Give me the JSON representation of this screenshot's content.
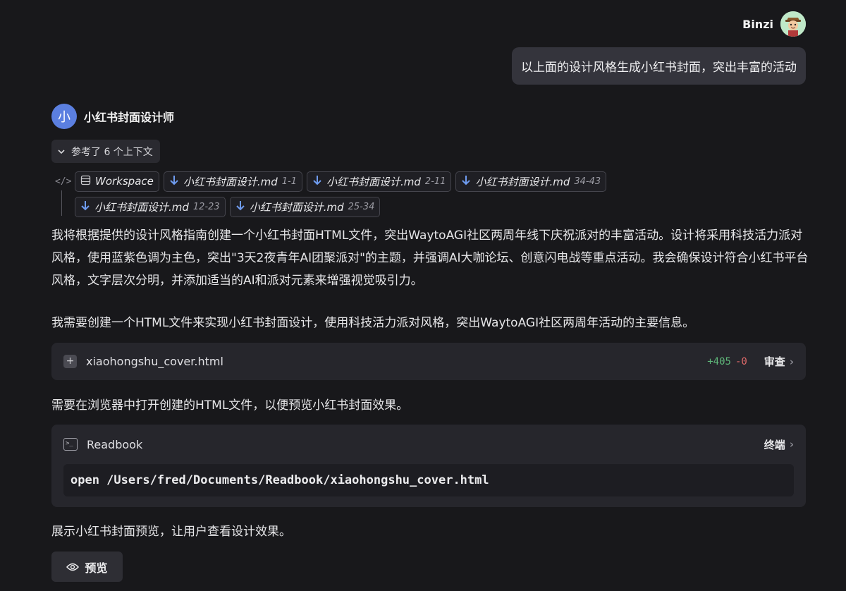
{
  "user": {
    "name": "Binzi",
    "message": "以上面的设计风格生成小红书封面，突出丰富的活动"
  },
  "assistant": {
    "avatar_text": "小",
    "name": "小红书封面设计师",
    "context_button": "参考了 6 个上下文",
    "context_row1": [
      {
        "label": "Workspace",
        "range": "",
        "icon": "database-icon"
      },
      {
        "label": "小红书封面设计.md",
        "range": "1-1",
        "icon": "arrow-down-icon"
      },
      {
        "label": "小红书封面设计.md",
        "range": "2-11",
        "icon": "arrow-down-icon"
      },
      {
        "label": "小红书封面设计.md",
        "range": "34-43",
        "icon": "arrow-down-icon"
      }
    ],
    "context_row2": [
      {
        "label": "小红书封面设计.md",
        "range": "12-23",
        "icon": "arrow-down-icon"
      },
      {
        "label": "小红书封面设计.md",
        "range": "25-34",
        "icon": "arrow-down-icon"
      }
    ],
    "para1": "我将根据提供的设计风格指南创建一个小红书封面HTML文件，突出WaytoAGI社区两周年线下庆祝派对的丰富活动。设计将采用科技活力派对风格，使用蓝紫色调为主色，突出\"3天2夜青年AI团聚派对\"的主题，并强调AI大咖论坛、创意闪电战等重点活动。我会确保设计符合小红书平台风格，文字层次分明，并添加适当的AI和派对元素来增强视觉吸引力。",
    "para2": "我需要创建一个HTML文件来实现小红书封面设计，使用科技活力派对风格，突出WaytoAGI社区两周年活动的主要信息。",
    "file_card": {
      "filename": "xiaohongshu_cover.html",
      "added": "+405",
      "removed": "-0",
      "action": "审查"
    },
    "para3": "需要在浏览器中打开创建的HTML文件，以便预览小红书封面效果。",
    "terminal": {
      "title": "Readbook",
      "action": "终端",
      "command": "open /Users/fred/Documents/Readbook/xiaohongshu_cover.html"
    },
    "para4": "展示小红书封面预览，让用户查看设计效果。",
    "preview_button": "预览"
  }
}
